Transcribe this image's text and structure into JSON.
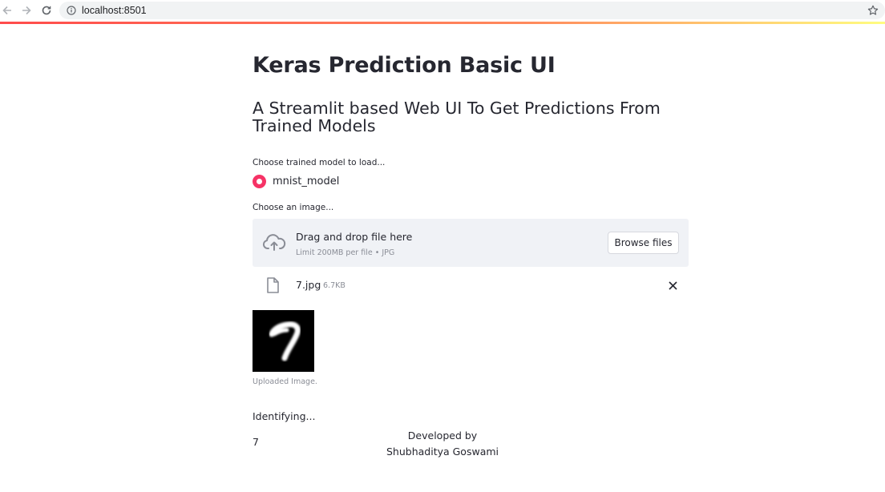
{
  "browser": {
    "url": "localhost:8501"
  },
  "app": {
    "title": "Keras Prediction Basic UI",
    "subtitle": "A Streamlit based Web UI To Get Predictions From Trained Models",
    "accent_color": "#f63366",
    "model_select": {
      "label": "Choose trained model to load...",
      "options": [
        "mnist_model"
      ],
      "selected": "mnist_model"
    },
    "uploader": {
      "label": "Choose an image...",
      "drag_text": "Drag and drop file here",
      "limit_text": "Limit 200MB per file • JPG",
      "browse_label": "Browse files",
      "file": {
        "name": "7.jpg",
        "size": "6.7KB"
      }
    },
    "image": {
      "caption": "Uploaded Image."
    },
    "status": "Identifying...",
    "prediction": "7"
  },
  "footer": {
    "line1": "Developed by",
    "line2": "Shubhaditya Goswami"
  }
}
